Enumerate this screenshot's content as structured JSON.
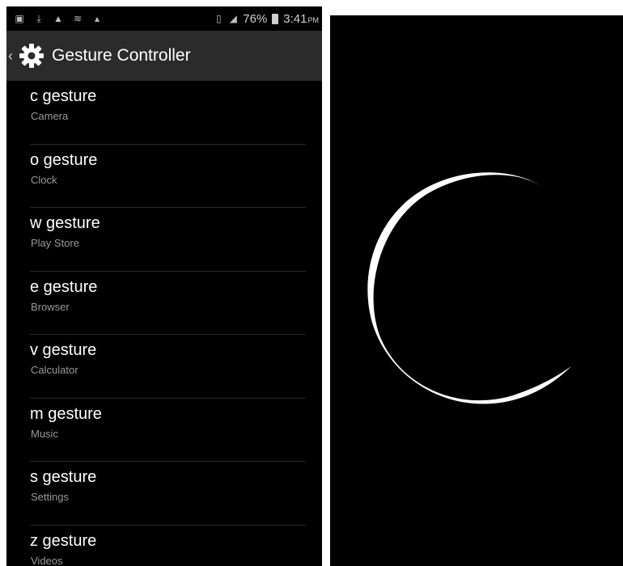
{
  "status_bar": {
    "battery_percent": "76%",
    "time": "3:41",
    "ampm": "PM"
  },
  "app_bar": {
    "title": "Gesture Controller"
  },
  "gestures": [
    {
      "title": "c gesture",
      "app": "Camera"
    },
    {
      "title": "o gesture",
      "app": "Clock"
    },
    {
      "title": "w gesture",
      "app": "Play Store"
    },
    {
      "title": "e gesture",
      "app": "Browser"
    },
    {
      "title": "v gesture",
      "app": "Calculator"
    },
    {
      "title": "m gesture",
      "app": "Music"
    },
    {
      "title": "s gesture",
      "app": "Settings"
    },
    {
      "title": "z gesture",
      "app": "Videos"
    }
  ],
  "colors": {
    "background": "#000000",
    "app_bar": "#2b2b2b",
    "primary_text": "#ffffff",
    "secondary_text": "#9a9a9a",
    "gesture_stroke": "#ffffff"
  }
}
